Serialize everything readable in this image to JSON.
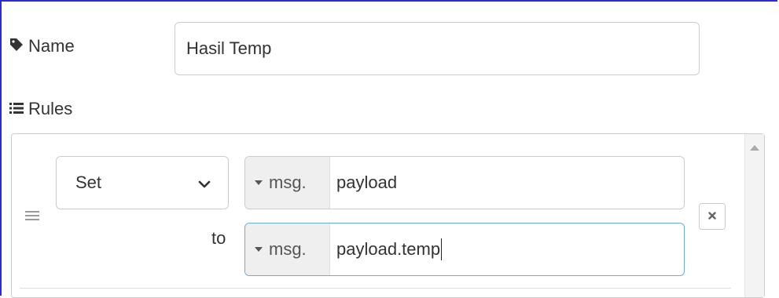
{
  "name_row": {
    "label": "Name",
    "value": "Hasil Temp",
    "icon": "tag-icon"
  },
  "rules_section": {
    "label": "Rules",
    "icon": "list-icon"
  },
  "rule": {
    "action": "Set",
    "to_label": "to",
    "target": {
      "type_label": "msg.",
      "value": "payload"
    },
    "source": {
      "type_label": "msg.",
      "value": "payload.temp"
    },
    "remove_icon": "close-icon"
  },
  "colors": {
    "frame_border": "#2b2bd9",
    "focus_border": "#6aaadf",
    "type_button_bg": "#efefef"
  }
}
